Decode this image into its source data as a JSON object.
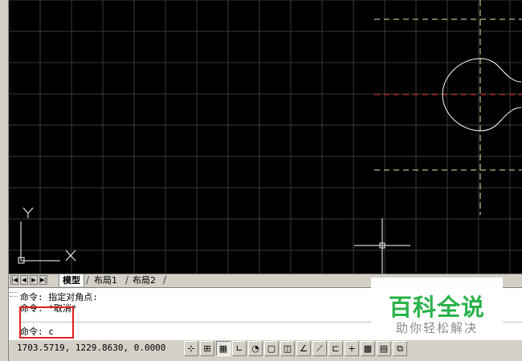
{
  "tabs": {
    "nav": [
      "|◀",
      "◀",
      "▶",
      "▶|"
    ],
    "items": [
      {
        "label": "模型",
        "active": true
      },
      {
        "label": "布局1",
        "active": false
      },
      {
        "label": "布局2",
        "active": false
      }
    ]
  },
  "command": {
    "history": [
      "命令: 指定对角点:",
      "命令: *取消*"
    ],
    "current": "命令: c"
  },
  "status": {
    "coordinates": "1703.5719, 1229.8630, 0.0000"
  },
  "toolbar": {
    "buttons": [
      {
        "name": "snap-mode-button",
        "glyph": "⊹",
        "on": false
      },
      {
        "name": "grid-display-button",
        "glyph": "⊞",
        "on": false
      },
      {
        "name": "grid-toggle-button",
        "glyph": "▦",
        "on": true
      },
      {
        "name": "ortho-mode-button",
        "glyph": "∟",
        "on": false
      },
      {
        "name": "polar-tracking-button",
        "glyph": "◔",
        "on": false
      },
      {
        "name": "object-snap-button",
        "glyph": "▢",
        "on": false
      },
      {
        "name": "3d-object-snap-button",
        "glyph": "◫",
        "on": false
      },
      {
        "name": "object-snap-tracking-button",
        "glyph": "∠",
        "on": false
      },
      {
        "name": "dynamic-ucs-button",
        "glyph": "⟋",
        "on": false
      },
      {
        "name": "dynamic-input-button",
        "glyph": "⊏",
        "on": false
      },
      {
        "name": "lineweight-button",
        "glyph": "+",
        "on": false
      },
      {
        "name": "transparency-button",
        "glyph": "▩",
        "on": false
      },
      {
        "name": "quick-properties-button",
        "glyph": "▤",
        "on": false
      },
      {
        "name": "selection-cycling-button",
        "glyph": "⧉",
        "on": false
      }
    ]
  },
  "colors": {
    "canvas_bg": "#000000",
    "grid": "#3a3a3a",
    "highlight": "#e02020",
    "yellow_dash": "#e8e8a0",
    "red_dash": "#e02020",
    "watermark_green": "#2bb34a"
  },
  "watermark": {
    "title": "百科全说",
    "subtitle": "助你轻松解决"
  }
}
